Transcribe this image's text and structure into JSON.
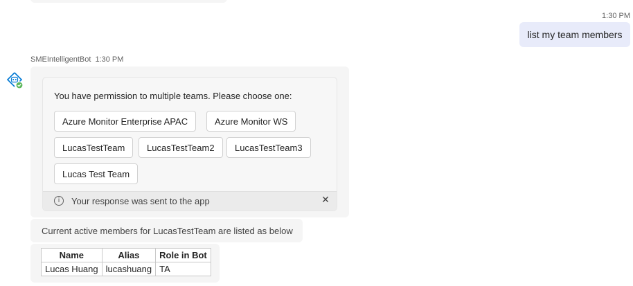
{
  "user_message": {
    "time": "1:30 PM",
    "text": "list my team members"
  },
  "bot": {
    "name": "SMEIntelligentBot",
    "time": "1:30 PM",
    "avatar_icon": "azure-bot-icon",
    "status_color": "#5bb75b"
  },
  "card": {
    "prompt": "You have permission to multiple teams. Please choose one:",
    "teams": [
      "Azure Monitor Enterprise APAC",
      "Azure Monitor WS",
      "LucasTestTeam",
      "LucasTestTeam2",
      "LucasTestTeam3",
      "Lucas Test Team"
    ],
    "footer": {
      "info_icon": "info-icon",
      "text": "Your response was sent to the app",
      "close_icon": "close-icon"
    }
  },
  "members_message": {
    "text": "Current active members for LucasTestTeam are listed as below",
    "table": {
      "headers": [
        "Name",
        "Alias",
        "Role in Bot"
      ],
      "rows": [
        [
          "Lucas Huang",
          "lucashuang",
          "TA"
        ]
      ]
    }
  },
  "colors": {
    "user_bubble": "#e8ebfa",
    "bot_bubble": "#f5f5f5",
    "bot_icon_blue": "#0078d4"
  }
}
